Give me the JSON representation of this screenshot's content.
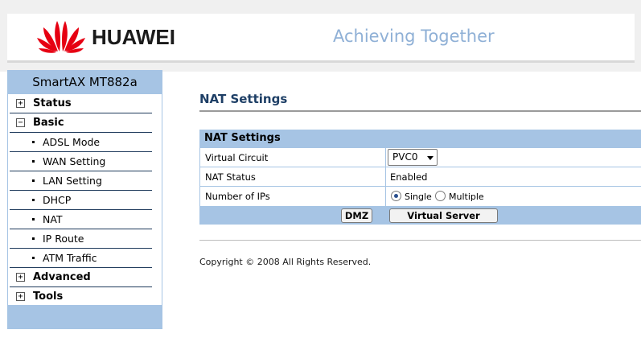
{
  "header": {
    "brand": "HUAWEI",
    "tagline": "Achieving Together",
    "brand_color": "#e60012",
    "tagline_color": "#8fb0d6"
  },
  "sidebar": {
    "title": "SmartAX MT882a",
    "items": [
      {
        "label": "Status",
        "icon": "plus-box-icon",
        "expanded": false
      },
      {
        "label": "Basic",
        "icon": "minus-box-icon",
        "expanded": true,
        "children": [
          "ADSL Mode",
          "WAN Setting",
          "LAN Setting",
          "DHCP",
          "NAT",
          "IP Route",
          "ATM Traffic"
        ]
      },
      {
        "label": "Advanced",
        "icon": "plus-box-icon",
        "expanded": false
      },
      {
        "label": "Tools",
        "icon": "plus-box-icon",
        "expanded": false
      }
    ],
    "expand_symbol": "+",
    "collapse_symbol": "−"
  },
  "main": {
    "page_title": "NAT Settings",
    "section_title": "NAT Settings",
    "rows": {
      "virtual_circuit": {
        "label": "Virtual Circuit",
        "value": "PVC0"
      },
      "nat_status": {
        "label": "NAT Status",
        "value": "Enabled"
      },
      "number_of_ips": {
        "label": "Number of IPs",
        "options": [
          "Single",
          "Multiple"
        ],
        "selected": "Single"
      }
    },
    "buttons": {
      "dmz": "DMZ",
      "virtual_server": "Virtual Server"
    },
    "copyright": "Copyright © 2008 All Rights Reserved."
  },
  "colors": {
    "accent_blue": "#a6c4e4",
    "title_blue": "#1e3f66"
  }
}
